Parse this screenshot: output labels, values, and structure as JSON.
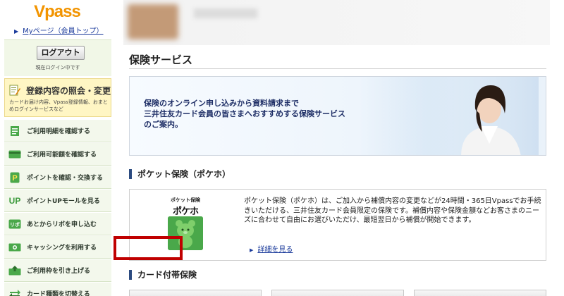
{
  "sidebar": {
    "logo": "Vpass",
    "mypage_link": "Myページ（会員トップ）",
    "logout_button": "ログアウト",
    "login_status": "現在ログイン中です",
    "registration": {
      "title": "登録内容の照会・変更",
      "description": "カードお届け内容、Vpass登録情報、おまとめログインサービスなど"
    },
    "menu": [
      {
        "label": "ご利用明細を確認する",
        "icon": "document-icon"
      },
      {
        "label": "ご利用可能額を確認する",
        "icon": "card-icon"
      },
      {
        "label": "ポイントを確認・交換する",
        "icon": "point-icon"
      },
      {
        "label": "ポイントUPモールを見る",
        "icon": "up-icon"
      },
      {
        "label": "あとからリボを申し込む",
        "icon": "revo-icon"
      },
      {
        "label": "キャッシングを利用する",
        "icon": "cash-icon"
      },
      {
        "label": "ご利用枠を引き上げる",
        "icon": "limit-up-icon"
      },
      {
        "label": "カード種類を切替える",
        "icon": "switch-icon"
      }
    ]
  },
  "main": {
    "page_title": "保険サービス",
    "banner_lines": [
      "保険のオンライン申し込みから資料請求まで",
      "三井住友カード会員の皆さまへおすすめする保険サービス",
      "のご案内。"
    ],
    "pocket_section": {
      "title": "ポケット保険（ポケホ）",
      "logo_small": "ポケット保険",
      "logo_big": "ポケホ",
      "description": "ポケット保険（ポケホ）は、ご加入から補償内容の変更などが24時間・365日Vpassでお手続きいただける、三井住友カード会員限定の保険です。補償内容や保険金額などお客さまのニーズに合わせて自由にお選びいただけ、最短翌日から補償が開始できます。",
      "details_link": "詳細を見る"
    },
    "card_section": {
      "title": "カード付帯保険"
    }
  },
  "colors": {
    "logo": "#f29400",
    "link": "#1a3a9b",
    "highlight": "#c00000",
    "section_bar": "#2c4b80"
  }
}
